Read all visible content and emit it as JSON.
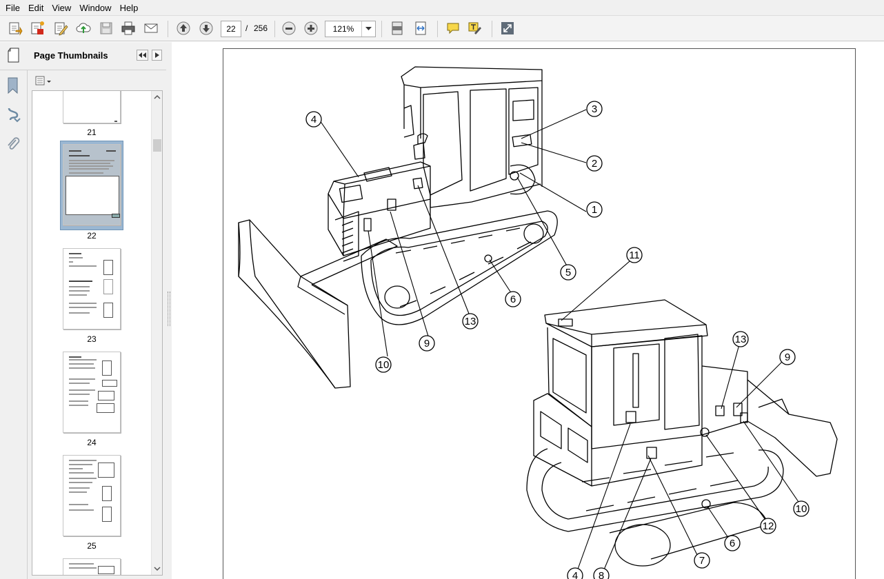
{
  "menu": [
    "File",
    "Edit",
    "View",
    "Window",
    "Help"
  ],
  "toolbar": {
    "page_current": "22",
    "page_separator": "/",
    "page_total": "256",
    "zoom": "121%"
  },
  "nav": {
    "title": "Page Thumbnails",
    "thumbnails": [
      {
        "label": "21"
      },
      {
        "label": "22"
      },
      {
        "label": "23"
      },
      {
        "label": "24"
      },
      {
        "label": "25"
      }
    ]
  },
  "callouts": [
    "1",
    "2",
    "3",
    "4",
    "5",
    "6",
    "9",
    "10",
    "13",
    "11",
    "13",
    "9",
    "10",
    "12",
    "6",
    "7",
    "4",
    "8"
  ]
}
